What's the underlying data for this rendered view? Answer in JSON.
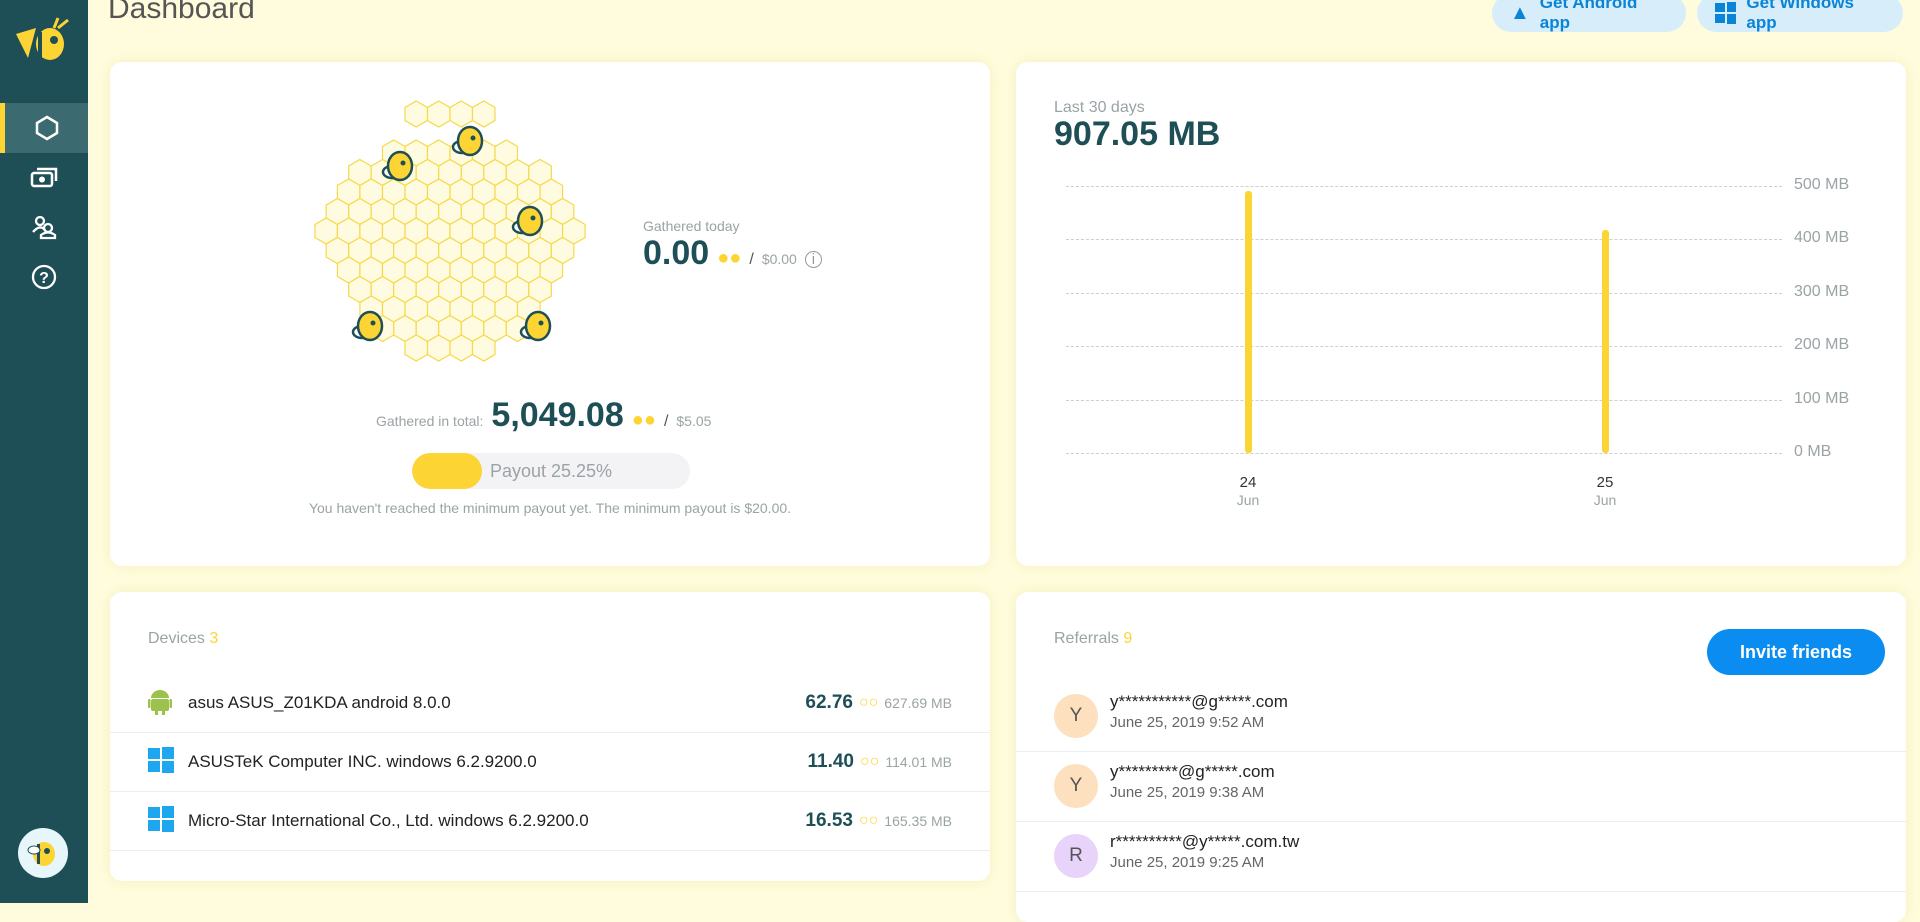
{
  "header": {
    "title": "Dashboard",
    "android_btn": "Get Android app",
    "windows_btn": "Get Windows app"
  },
  "sidebar": {
    "items": [
      {
        "icon": "hexagon-icon",
        "active": true
      },
      {
        "icon": "money-icon"
      },
      {
        "icon": "users-icon"
      },
      {
        "icon": "help-icon"
      }
    ]
  },
  "earnings": {
    "today_label": "Gathered today",
    "today_value": "0.00",
    "today_usd": "$0.00",
    "total_label": "Gathered in total:",
    "total_value": "5,049.08",
    "total_usd": "$5.05",
    "payout_label": "Payout 25.25%",
    "payout_percent": 25.25,
    "note": "You haven't reached the minimum payout yet. The minimum payout is $20.00.",
    "separator": "/"
  },
  "chart_data": {
    "type": "bar",
    "subtitle": "Last 30 days",
    "total": "907.05 MB",
    "categories": [
      {
        "day": "24",
        "month": "Jun"
      },
      {
        "day": "25",
        "month": "Jun"
      }
    ],
    "values": [
      490,
      417
    ],
    "yunit": "MB",
    "ylim": [
      0,
      500
    ],
    "yticks": [
      "500 MB",
      "400 MB",
      "300 MB",
      "200 MB",
      "100 MB",
      "0 MB"
    ],
    "grid": true,
    "color": "#fcd535"
  },
  "devices": {
    "label": "Devices",
    "count": "3",
    "items": [
      {
        "os": "android",
        "name": "asus ASUS_Z01KDA android 8.0.0",
        "value": "62.76",
        "size": "627.69 MB"
      },
      {
        "os": "windows",
        "name": "ASUSTeK Computer INC. windows 6.2.9200.0",
        "value": "11.40",
        "size": "114.01 MB"
      },
      {
        "os": "windows",
        "name": "Micro-Star International Co., Ltd. windows 6.2.9200.0",
        "value": "16.53",
        "size": "165.35 MB"
      }
    ]
  },
  "referrals": {
    "label": "Referrals",
    "count": "9",
    "invite": "Invite friends",
    "items": [
      {
        "initial": "Y",
        "email": "y***********@g*****.com",
        "date": "June 25, 2019 9:52 AM",
        "color": "#fde0bd"
      },
      {
        "initial": "Y",
        "email": "y*********@g*****.com",
        "date": "June 25, 2019 9:38 AM",
        "color": "#fde0bd"
      },
      {
        "initial": "R",
        "email": "r**********@y*****.com.tw",
        "date": "June 25, 2019 9:25 AM",
        "color": "#e8d3fb"
      }
    ]
  },
  "colors": {
    "sidebar": "#1f4f56",
    "accent": "#fcd535",
    "button": "#0a8cf0",
    "background": "#fefcdc"
  }
}
